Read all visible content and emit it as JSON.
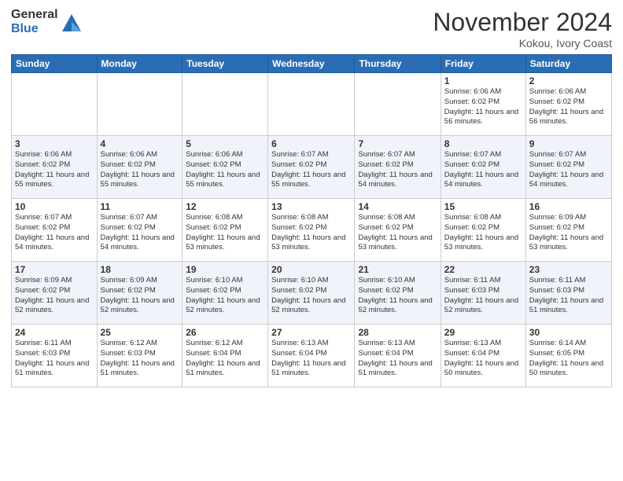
{
  "logo": {
    "general": "General",
    "blue": "Blue"
  },
  "header": {
    "month": "November 2024",
    "location": "Kokou, Ivory Coast"
  },
  "weekdays": [
    "Sunday",
    "Monday",
    "Tuesday",
    "Wednesday",
    "Thursday",
    "Friday",
    "Saturday"
  ],
  "weeks": [
    [
      {
        "day": "",
        "info": ""
      },
      {
        "day": "",
        "info": ""
      },
      {
        "day": "",
        "info": ""
      },
      {
        "day": "",
        "info": ""
      },
      {
        "day": "",
        "info": ""
      },
      {
        "day": "1",
        "info": "Sunrise: 6:06 AM\nSunset: 6:02 PM\nDaylight: 11 hours\nand 56 minutes."
      },
      {
        "day": "2",
        "info": "Sunrise: 6:06 AM\nSunset: 6:02 PM\nDaylight: 11 hours\nand 56 minutes."
      }
    ],
    [
      {
        "day": "3",
        "info": "Sunrise: 6:06 AM\nSunset: 6:02 PM\nDaylight: 11 hours\nand 55 minutes."
      },
      {
        "day": "4",
        "info": "Sunrise: 6:06 AM\nSunset: 6:02 PM\nDaylight: 11 hours\nand 55 minutes."
      },
      {
        "day": "5",
        "info": "Sunrise: 6:06 AM\nSunset: 6:02 PM\nDaylight: 11 hours\nand 55 minutes."
      },
      {
        "day": "6",
        "info": "Sunrise: 6:07 AM\nSunset: 6:02 PM\nDaylight: 11 hours\nand 55 minutes."
      },
      {
        "day": "7",
        "info": "Sunrise: 6:07 AM\nSunset: 6:02 PM\nDaylight: 11 hours\nand 54 minutes."
      },
      {
        "day": "8",
        "info": "Sunrise: 6:07 AM\nSunset: 6:02 PM\nDaylight: 11 hours\nand 54 minutes."
      },
      {
        "day": "9",
        "info": "Sunrise: 6:07 AM\nSunset: 6:02 PM\nDaylight: 11 hours\nand 54 minutes."
      }
    ],
    [
      {
        "day": "10",
        "info": "Sunrise: 6:07 AM\nSunset: 6:02 PM\nDaylight: 11 hours\nand 54 minutes."
      },
      {
        "day": "11",
        "info": "Sunrise: 6:07 AM\nSunset: 6:02 PM\nDaylight: 11 hours\nand 54 minutes."
      },
      {
        "day": "12",
        "info": "Sunrise: 6:08 AM\nSunset: 6:02 PM\nDaylight: 11 hours\nand 53 minutes."
      },
      {
        "day": "13",
        "info": "Sunrise: 6:08 AM\nSunset: 6:02 PM\nDaylight: 11 hours\nand 53 minutes."
      },
      {
        "day": "14",
        "info": "Sunrise: 6:08 AM\nSunset: 6:02 PM\nDaylight: 11 hours\nand 53 minutes."
      },
      {
        "day": "15",
        "info": "Sunrise: 6:08 AM\nSunset: 6:02 PM\nDaylight: 11 hours\nand 53 minutes."
      },
      {
        "day": "16",
        "info": "Sunrise: 6:09 AM\nSunset: 6:02 PM\nDaylight: 11 hours\nand 53 minutes."
      }
    ],
    [
      {
        "day": "17",
        "info": "Sunrise: 6:09 AM\nSunset: 6:02 PM\nDaylight: 11 hours\nand 52 minutes."
      },
      {
        "day": "18",
        "info": "Sunrise: 6:09 AM\nSunset: 6:02 PM\nDaylight: 11 hours\nand 52 minutes."
      },
      {
        "day": "19",
        "info": "Sunrise: 6:10 AM\nSunset: 6:02 PM\nDaylight: 11 hours\nand 52 minutes."
      },
      {
        "day": "20",
        "info": "Sunrise: 6:10 AM\nSunset: 6:02 PM\nDaylight: 11 hours\nand 52 minutes."
      },
      {
        "day": "21",
        "info": "Sunrise: 6:10 AM\nSunset: 6:02 PM\nDaylight: 11 hours\nand 52 minutes."
      },
      {
        "day": "22",
        "info": "Sunrise: 6:11 AM\nSunset: 6:03 PM\nDaylight: 11 hours\nand 52 minutes."
      },
      {
        "day": "23",
        "info": "Sunrise: 6:11 AM\nSunset: 6:03 PM\nDaylight: 11 hours\nand 51 minutes."
      }
    ],
    [
      {
        "day": "24",
        "info": "Sunrise: 6:11 AM\nSunset: 6:03 PM\nDaylight: 11 hours\nand 51 minutes."
      },
      {
        "day": "25",
        "info": "Sunrise: 6:12 AM\nSunset: 6:03 PM\nDaylight: 11 hours\nand 51 minutes."
      },
      {
        "day": "26",
        "info": "Sunrise: 6:12 AM\nSunset: 6:04 PM\nDaylight: 11 hours\nand 51 minutes."
      },
      {
        "day": "27",
        "info": "Sunrise: 6:13 AM\nSunset: 6:04 PM\nDaylight: 11 hours\nand 51 minutes."
      },
      {
        "day": "28",
        "info": "Sunrise: 6:13 AM\nSunset: 6:04 PM\nDaylight: 11 hours\nand 51 minutes."
      },
      {
        "day": "29",
        "info": "Sunrise: 6:13 AM\nSunset: 6:04 PM\nDaylight: 11 hours\nand 50 minutes."
      },
      {
        "day": "30",
        "info": "Sunrise: 6:14 AM\nSunset: 6:05 PM\nDaylight: 11 hours\nand 50 minutes."
      }
    ]
  ]
}
